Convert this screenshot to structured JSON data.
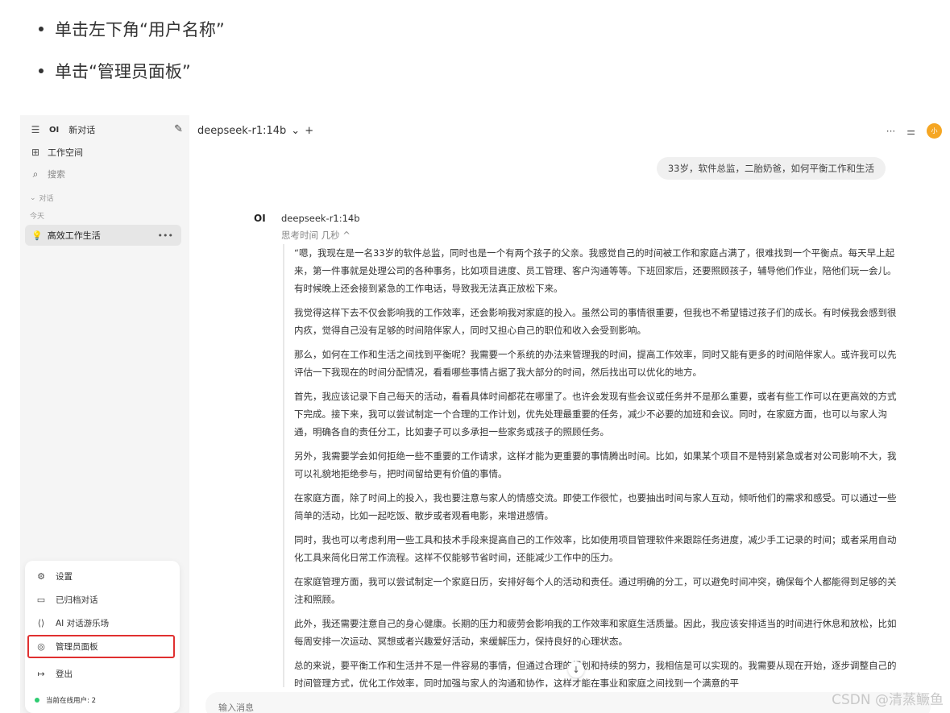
{
  "instructions": {
    "step1": "单击左下角“用户名称”",
    "step2": "单击“管理员面板”"
  },
  "sidebar": {
    "brand": "OI",
    "new_chat": "新对话",
    "workspace": "工作空间",
    "search_placeholder": "搜索",
    "section_chats": "对话",
    "group_today": "今天",
    "chat_title": "高效工作生活",
    "more": "•••"
  },
  "user_menu": {
    "items": [
      "设置",
      "已归档对话",
      "AI 对话游乐场",
      "管理员面板",
      "登出"
    ],
    "online_users": "当前在线用户: 2"
  },
  "header": {
    "model": "deepseek-r1:14b",
    "add": "+",
    "more": "···",
    "avatar_initial": "小"
  },
  "chat": {
    "user_message": "33岁，软件总监，二胎奶爸，如何平衡工作和生活",
    "ai_logo": "OI",
    "ai_name": "deepseek-r1:14b",
    "thinking_label": "思考时间 几秒 ^",
    "reasoning": [
      "“嗯，我现在是一名33岁的软件总监，同时也是一个有两个孩子的父亲。我感觉自己的时间被工作和家庭占满了，很难找到一个平衡点。每天早上起来，第一件事就是处理公司的各种事务，比如项目进度、员工管理、客户沟通等等。下班回家后，还要照顾孩子，辅导他们作业，陪他们玩一会儿。有时候晚上还会接到紧急的工作电话，导致我无法真正放松下来。",
      "我觉得这样下去不仅会影响我的工作效率，还会影响我对家庭的投入。虽然公司的事情很重要，但我也不希望错过孩子们的成长。有时候我会感到很内疚，觉得自己没有足够的时间陪伴家人，同时又担心自己的职位和收入会受到影响。",
      "那么，如何在工作和生活之间找到平衡呢？我需要一个系统的办法来管理我的时间，提高工作效率，同时又能有更多的时间陪伴家人。或许我可以先评估一下我现在的时间分配情况，看看哪些事情占据了我大部分的时间，然后找出可以优化的地方。",
      "首先，我应该记录下自己每天的活动，看看具体时间都花在哪里了。也许会发现有些会议或任务并不是那么重要，或者有些工作可以在更高效的方式下完成。接下来，我可以尝试制定一个合理的工作计划，优先处理最重要的任务，减少不必要的加班和会议。同时，在家庭方面，也可以与家人沟通，明确各自的责任分工，比如妻子可以多承担一些家务或孩子的照顾任务。",
      "另外，我需要学会如何拒绝一些不重要的工作请求，这样才能为更重要的事情腾出时间。比如，如果某个项目不是特别紧急或者对公司影响不大，我可以礼貌地拒绝参与，把时间留给更有价值的事情。",
      "在家庭方面，除了时间上的投入，我也要注意与家人的情感交流。即使工作很忙，也要抽出时间与家人互动，倾听他们的需求和感受。可以通过一些简单的活动，比如一起吃饭、散步或者观看电影，来增进感情。",
      "同时，我也可以考虑利用一些工具和技术手段来提高自己的工作效率，比如使用项目管理软件来跟踪任务进度，减少手工记录的时间；或者采用自动化工具来简化日常工作流程。这样不仅能够节省时间，还能减少工作中的压力。",
      "在家庭管理方面，我可以尝试制定一个家庭日历，安排好每个人的活动和责任。通过明确的分工，可以避免时间冲突，确保每个人都能得到足够的关注和照顾。",
      "此外，我还需要注意自己的身心健康。长期的压力和疲劳会影响我的工作效率和家庭生活质量。因此，我应该安排适当的时间进行休息和放松，比如每周安排一次运动、冥想或者兴趣爱好活动，来缓解压力，保持良好的心理状态。",
      "总的来说，要平衡工作和生活并不是一件容易的事情，但通过合理的规划和持续的努力，我相信是可以实现的。我需要从现在开始，逐步调整自己的时间管理方式，优化工作效率，同时加强与家人的沟通和协作，这样才能在事业和家庭之间找到一个满意的平"
    ],
    "input_placeholder": "输入消息"
  },
  "watermark": "CSDN @清蒸鳜鱼"
}
